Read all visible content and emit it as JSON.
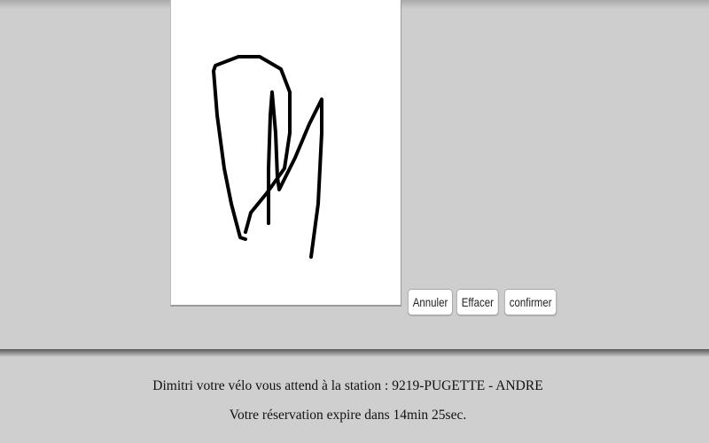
{
  "signature_pad": {
    "stroke_color": "#000000"
  },
  "buttons": {
    "cancel_label": "Annuler",
    "clear_label": "Effacer",
    "confirm_label": "confirmer"
  },
  "message": {
    "station_line": "Dimitri votre vélo vous attend à la station : 9219-PUGETTE - ANDRE",
    "expiry_line": "Votre réservation expire dans 14min 25sec."
  }
}
